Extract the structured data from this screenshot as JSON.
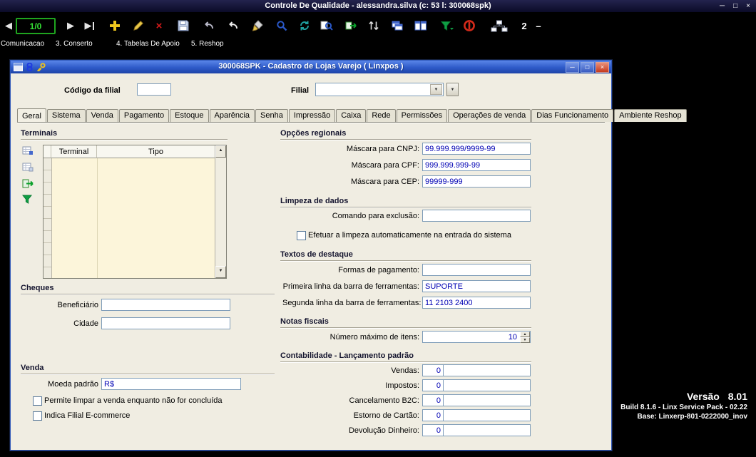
{
  "titlebar": {
    "title": "Controle De Qualidade - alessandra.silva (c: 53 l: 300068spk)",
    "minimize": "─",
    "maximize": "□",
    "close": "×"
  },
  "toolbar": {
    "record_counter": "1/0",
    "open_windows_count": "2"
  },
  "menubar": {
    "items": [
      "Comunicacao",
      "3. Conserto",
      "4. Tabelas De Apoio",
      "5. Reshop"
    ]
  },
  "child_window": {
    "title": "300068SPK - Cadastro de Lojas Varejo ( Linxpos )",
    "minimize": "─",
    "maximize": "□",
    "close": "×",
    "header_fields": {
      "codigo_label": "Código da filial",
      "codigo_value": "",
      "filial_label": "Filial",
      "filial_value": ""
    },
    "tabs": [
      "Geral",
      "Sistema",
      "Venda",
      "Pagamento",
      "Estoque",
      "Aparência",
      "Senha",
      "Impressão",
      "Caixa",
      "Rede",
      "Permissões",
      "Operações de venda",
      "Dias Funcionamento",
      "Ambiente Reshop"
    ],
    "active_tab": "Geral",
    "terminais": {
      "title": "Terminais",
      "columns": [
        "Terminal",
        "Tipo"
      ],
      "rows": []
    },
    "cheques": {
      "title": "Cheques",
      "beneficiario_label": "Beneficiário",
      "beneficiario_value": "",
      "cidade_label": "Cidade",
      "cidade_value": ""
    },
    "venda": {
      "title": "Venda",
      "moeda_label": "Moeda padrão",
      "moeda_value": "R$",
      "checkbox1": "Permite limpar a venda enquanto não for concluída",
      "checkbox1_checked": false,
      "checkbox2": "Indica Filial E-commerce",
      "checkbox2_checked": false
    },
    "opcoes_regionais": {
      "title": "Opções regionais",
      "cnpj_label": "Máscara para CNPJ:",
      "cnpj_value": "99.999.999/9999-99",
      "cpf_label": "Máscara para CPF:",
      "cpf_value": "999.999.999-99",
      "cep_label": "Máscara para CEP:",
      "cep_value": "99999-999"
    },
    "limpeza": {
      "title": "Limpeza de dados",
      "comando_label": "Comando para exclusão:",
      "comando_value": "",
      "checkbox": "Efetuar a limpeza automaticamente na entrada do sistema",
      "checkbox_checked": false
    },
    "textos": {
      "title": "Textos de destaque",
      "formas_label": "Formas de pagamento:",
      "formas_value": "",
      "linha1_label": "Primeira linha da barra de ferramentas:",
      "linha1_value": "SUPORTE",
      "linha2_label": "Segunda linha da barra de ferramentas:",
      "linha2_value": "11 2103 2400"
    },
    "notas": {
      "title": "Notas fiscais",
      "max_itens_label": "Número máximo de itens:",
      "max_itens_value": "10"
    },
    "contabilidade": {
      "title": "Contabilidade - Lançamento padrão",
      "rows": [
        {
          "label": "Vendas:",
          "code": "0",
          "desc": ""
        },
        {
          "label": "Impostos:",
          "code": "0",
          "desc": ""
        },
        {
          "label": "Cancelamento B2C:",
          "code": "0",
          "desc": ""
        },
        {
          "label": "Estorno de Cartão:",
          "code": "0",
          "desc": ""
        },
        {
          "label": "Devolução Dinheiro:",
          "code": "0",
          "desc": ""
        }
      ]
    }
  },
  "version_info": {
    "line1": "Versão 8.01",
    "line2": "Build 8.1.6 - Linx Service Pack - 02.22",
    "line3": "Base: Linxerp-801-0222000_inov"
  },
  "colors": {
    "record_counter_green": "#35e035",
    "value_text_blue": "#0000b4",
    "child_titlebar_blue": "#2e5ac8",
    "grid_body_cream": "#fcf5da"
  }
}
